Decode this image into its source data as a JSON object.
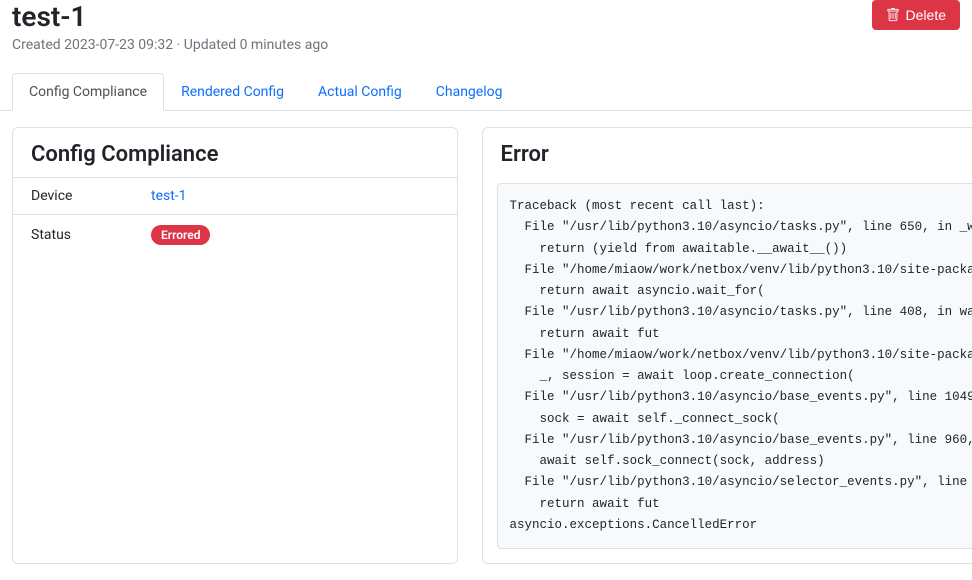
{
  "header": {
    "title": "test-1",
    "meta": "Created 2023-07-23 09:32 · Updated 0 minutes ago",
    "delete_label": "Delete"
  },
  "tabs": {
    "compliance": "Config Compliance",
    "rendered": "Rendered Config",
    "actual": "Actual Config",
    "changelog": "Changelog"
  },
  "compliance_card": {
    "title": "Config Compliance",
    "device_label": "Device",
    "device_value": "test-1",
    "status_label": "Status",
    "status_value": "Errored"
  },
  "error_card": {
    "title": "Error",
    "traceback": "Traceback (most recent call last):\n  File \"/usr/lib/python3.10/asyncio/tasks.py\", line 650, in _w\n    return (yield from awaitable.__await__())\n  File \"/home/miaow/work/netbox/venv/lib/python3.10/site-packa\n    return await asyncio.wait_for(\n  File \"/usr/lib/python3.10/asyncio/tasks.py\", line 408, in wa\n    return await fut\n  File \"/home/miaow/work/netbox/venv/lib/python3.10/site-packa\n    _, session = await loop.create_connection(\n  File \"/usr/lib/python3.10/asyncio/base_events.py\", line 1049\n    sock = await self._connect_sock(\n  File \"/usr/lib/python3.10/asyncio/base_events.py\", line 960,\n    await self.sock_connect(sock, address)\n  File \"/usr/lib/python3.10/asyncio/selector_events.py\", line \n    return await fut\nasyncio.exceptions.CancelledError"
  }
}
